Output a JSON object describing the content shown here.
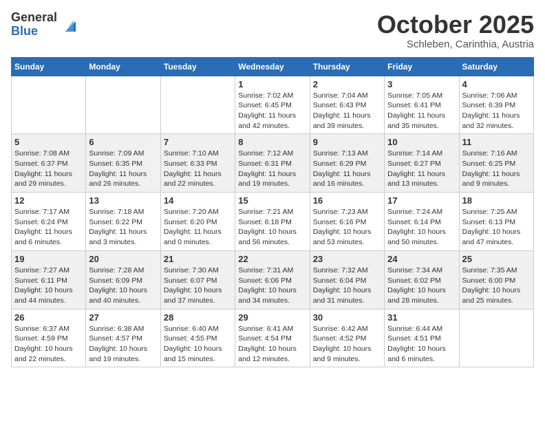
{
  "logo": {
    "general": "General",
    "blue": "Blue"
  },
  "header": {
    "month": "October 2025",
    "location": "Schleben, Carinthia, Austria"
  },
  "days_of_week": [
    "Sunday",
    "Monday",
    "Tuesday",
    "Wednesday",
    "Thursday",
    "Friday",
    "Saturday"
  ],
  "weeks": [
    [
      {
        "day": "",
        "info": ""
      },
      {
        "day": "",
        "info": ""
      },
      {
        "day": "",
        "info": ""
      },
      {
        "day": "1",
        "info": "Sunrise: 7:02 AM\nSunset: 6:45 PM\nDaylight: 11 hours and 42 minutes."
      },
      {
        "day": "2",
        "info": "Sunrise: 7:04 AM\nSunset: 6:43 PM\nDaylight: 11 hours and 39 minutes."
      },
      {
        "day": "3",
        "info": "Sunrise: 7:05 AM\nSunset: 6:41 PM\nDaylight: 11 hours and 35 minutes."
      },
      {
        "day": "4",
        "info": "Sunrise: 7:06 AM\nSunset: 6:39 PM\nDaylight: 11 hours and 32 minutes."
      }
    ],
    [
      {
        "day": "5",
        "info": "Sunrise: 7:08 AM\nSunset: 6:37 PM\nDaylight: 11 hours and 29 minutes."
      },
      {
        "day": "6",
        "info": "Sunrise: 7:09 AM\nSunset: 6:35 PM\nDaylight: 11 hours and 26 minutes."
      },
      {
        "day": "7",
        "info": "Sunrise: 7:10 AM\nSunset: 6:33 PM\nDaylight: 11 hours and 22 minutes."
      },
      {
        "day": "8",
        "info": "Sunrise: 7:12 AM\nSunset: 6:31 PM\nDaylight: 11 hours and 19 minutes."
      },
      {
        "day": "9",
        "info": "Sunrise: 7:13 AM\nSunset: 6:29 PM\nDaylight: 11 hours and 16 minutes."
      },
      {
        "day": "10",
        "info": "Sunrise: 7:14 AM\nSunset: 6:27 PM\nDaylight: 11 hours and 13 minutes."
      },
      {
        "day": "11",
        "info": "Sunrise: 7:16 AM\nSunset: 6:25 PM\nDaylight: 11 hours and 9 minutes."
      }
    ],
    [
      {
        "day": "12",
        "info": "Sunrise: 7:17 AM\nSunset: 6:24 PM\nDaylight: 11 hours and 6 minutes."
      },
      {
        "day": "13",
        "info": "Sunrise: 7:18 AM\nSunset: 6:22 PM\nDaylight: 11 hours and 3 minutes."
      },
      {
        "day": "14",
        "info": "Sunrise: 7:20 AM\nSunset: 6:20 PM\nDaylight: 11 hours and 0 minutes."
      },
      {
        "day": "15",
        "info": "Sunrise: 7:21 AM\nSunset: 6:18 PM\nDaylight: 10 hours and 56 minutes."
      },
      {
        "day": "16",
        "info": "Sunrise: 7:23 AM\nSunset: 6:16 PM\nDaylight: 10 hours and 53 minutes."
      },
      {
        "day": "17",
        "info": "Sunrise: 7:24 AM\nSunset: 6:14 PM\nDaylight: 10 hours and 50 minutes."
      },
      {
        "day": "18",
        "info": "Sunrise: 7:25 AM\nSunset: 6:13 PM\nDaylight: 10 hours and 47 minutes."
      }
    ],
    [
      {
        "day": "19",
        "info": "Sunrise: 7:27 AM\nSunset: 6:11 PM\nDaylight: 10 hours and 44 minutes."
      },
      {
        "day": "20",
        "info": "Sunrise: 7:28 AM\nSunset: 6:09 PM\nDaylight: 10 hours and 40 minutes."
      },
      {
        "day": "21",
        "info": "Sunrise: 7:30 AM\nSunset: 6:07 PM\nDaylight: 10 hours and 37 minutes."
      },
      {
        "day": "22",
        "info": "Sunrise: 7:31 AM\nSunset: 6:06 PM\nDaylight: 10 hours and 34 minutes."
      },
      {
        "day": "23",
        "info": "Sunrise: 7:32 AM\nSunset: 6:04 PM\nDaylight: 10 hours and 31 minutes."
      },
      {
        "day": "24",
        "info": "Sunrise: 7:34 AM\nSunset: 6:02 PM\nDaylight: 10 hours and 28 minutes."
      },
      {
        "day": "25",
        "info": "Sunrise: 7:35 AM\nSunset: 6:00 PM\nDaylight: 10 hours and 25 minutes."
      }
    ],
    [
      {
        "day": "26",
        "info": "Sunrise: 6:37 AM\nSunset: 4:59 PM\nDaylight: 10 hours and 22 minutes."
      },
      {
        "day": "27",
        "info": "Sunrise: 6:38 AM\nSunset: 4:57 PM\nDaylight: 10 hours and 19 minutes."
      },
      {
        "day": "28",
        "info": "Sunrise: 6:40 AM\nSunset: 4:55 PM\nDaylight: 10 hours and 15 minutes."
      },
      {
        "day": "29",
        "info": "Sunrise: 6:41 AM\nSunset: 4:54 PM\nDaylight: 10 hours and 12 minutes."
      },
      {
        "day": "30",
        "info": "Sunrise: 6:42 AM\nSunset: 4:52 PM\nDaylight: 10 hours and 9 minutes."
      },
      {
        "day": "31",
        "info": "Sunrise: 6:44 AM\nSunset: 4:51 PM\nDaylight: 10 hours and 6 minutes."
      },
      {
        "day": "",
        "info": ""
      }
    ]
  ]
}
